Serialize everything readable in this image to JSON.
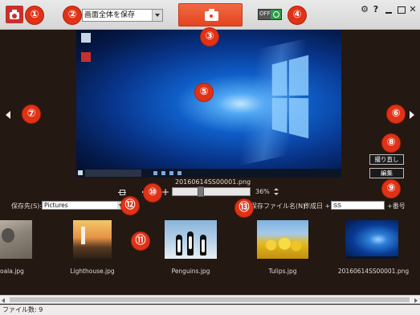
{
  "toolbar": {
    "mode_select_value": "画面全体を保存",
    "timer_toggle_text": "OFF"
  },
  "preview": {
    "filename": "20160614SS00001.png",
    "zoom_value": "36%",
    "zoom_level": 0.36
  },
  "side_buttons": {
    "retake": "撮り直し",
    "edit": "編集"
  },
  "save_settings": {
    "dest_label": "保存先(S):",
    "dest_value": "Pictures",
    "filename_rule_label": "保存ファイル名(N):",
    "filename_prefix": "作成日 +",
    "filename_field": "SS",
    "filename_suffix": "+番号"
  },
  "thumbnails": [
    {
      "label": "oala.jpg"
    },
    {
      "label": "Lighthouse.jpg"
    },
    {
      "label": "Penguins.jpg"
    },
    {
      "label": "Tulips.jpg"
    },
    {
      "label": "20160614SS00001.png"
    }
  ],
  "status": {
    "file_count": "ファイル数: 9"
  },
  "markers": [
    "①",
    "②",
    "③",
    "④",
    "⑤",
    "⑥",
    "⑦",
    "⑧",
    "⑨",
    "⑩",
    "⑪",
    "⑫",
    "⑬"
  ],
  "icons": [
    "app-logo-icon",
    "camera-icon",
    "timer-clock-icon",
    "gear-icon",
    "help-icon",
    "minimize-icon",
    "maximize-icon",
    "close-icon",
    "chevron-left-icon",
    "chevron-right-icon",
    "zoom-fit-icon"
  ],
  "colors": {
    "background": "#241812",
    "capture_button": "#e4431f",
    "marker": "#e03217",
    "timer_green": "#2e9a48"
  }
}
